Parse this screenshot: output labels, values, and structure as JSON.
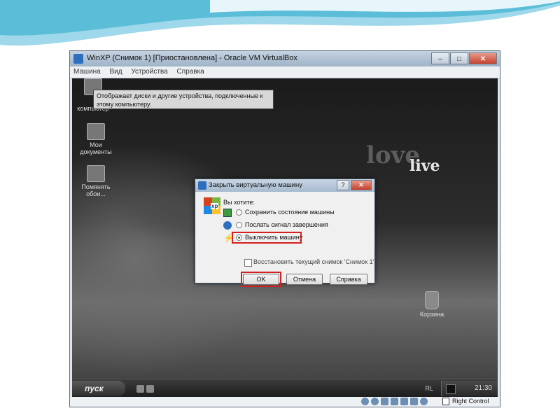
{
  "vbox": {
    "title": "WinXP (Снимок 1) [Приостановлена] - Oracle VM VirtualBox",
    "window_buttons": {
      "minimize": "–",
      "maximize": "□",
      "close": "✕"
    },
    "menu": [
      "Машина",
      "Вид",
      "Устройства",
      "Справка"
    ],
    "status": {
      "host_key": "Right Control"
    }
  },
  "guest": {
    "tooltip": "Отображает диски и другие устройства, подключенные к этому компьютеру.",
    "wallpaper_text": [
      "love",
      "live"
    ],
    "desktop_icons": {
      "my_computer": "компьютер",
      "my_documents": "Мои документы",
      "network": "Помянять обои...",
      "recycle_bin": "Корзина"
    },
    "taskbar": {
      "start": "пуск",
      "lang": "RL",
      "clock": "21:30"
    }
  },
  "dialog": {
    "title": "Закрыть виртуальную машину",
    "help_button": "?",
    "close_button": "✕",
    "logo_text": "xp",
    "question": "Вы хотите:",
    "options": [
      {
        "label": "Сохранить состояние машины",
        "selected": false
      },
      {
        "label": "Послать сигнал завершения",
        "selected": false
      },
      {
        "label": "Выключить машину",
        "selected": true
      }
    ],
    "restore_snapshot": "Восстановить текущий снимок 'Снимок 1'",
    "buttons": {
      "ok": "OK",
      "cancel": "Отмена",
      "help": "Справка"
    }
  },
  "colors": {
    "highlight": "#d42020",
    "accent": "#2d6fbf"
  },
  "icons": [
    "vbox-icon",
    "xp-logo-icon",
    "save-state-icon",
    "acpi-icon",
    "power-icon",
    "hdd-icon",
    "cd-icon",
    "usb-icon",
    "network-icon",
    "shared-folder-icon",
    "display-icon",
    "mouse-integration-icon",
    "host-key-icon"
  ]
}
